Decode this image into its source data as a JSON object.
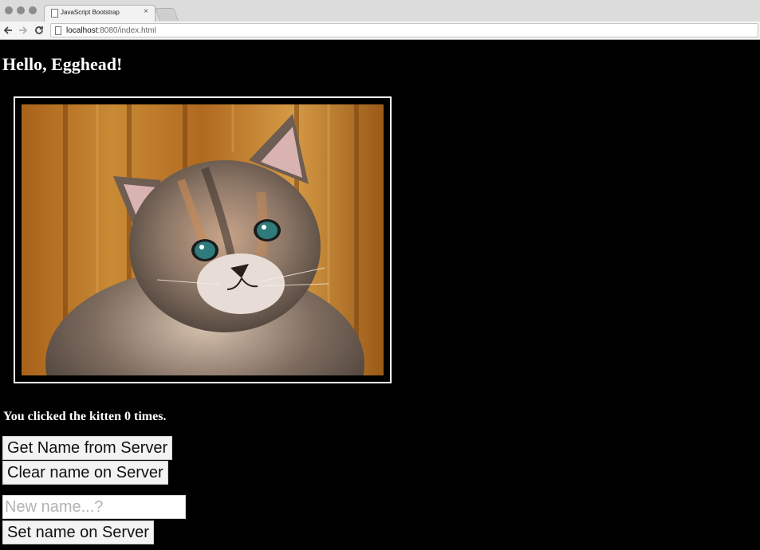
{
  "browser": {
    "tab_title": "JavaScript Bootstrap",
    "tab_close": "×",
    "url_host": "localhost",
    "url_path": ":8080/index.html",
    "back_icon": "arrow-left-icon",
    "forward_icon": "arrow-right-icon",
    "reload_icon": "reload-icon"
  },
  "page": {
    "heading": "Hello, Egghead!",
    "kitten_image_alt": "kitten photo",
    "click_message": "You clicked the kitten 0 times.",
    "buttons": {
      "get_name": "Get Name from Server",
      "clear_name": "Clear name on Server",
      "set_name": "Set name on Server"
    },
    "name_input": {
      "value": "",
      "placeholder": "New name...?"
    }
  },
  "colors": {
    "page_background": "#000000",
    "text": "#ffffff",
    "button_background": "#f3f3f3",
    "photo_background": "#b8731f"
  }
}
